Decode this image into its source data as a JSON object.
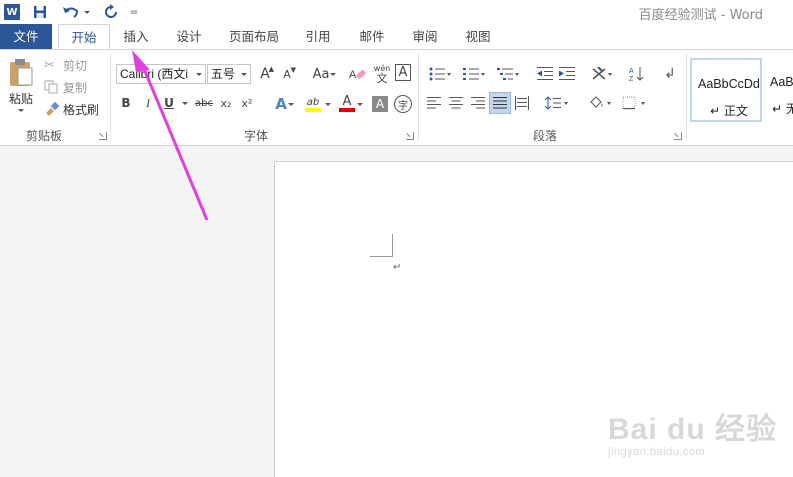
{
  "titlebar": {
    "title": "百度经验测试 - Word",
    "word_icon_text": "W",
    "qat_more": "="
  },
  "tabs": [
    "文件",
    "开始",
    "插入",
    "设计",
    "页面布局",
    "引用",
    "邮件",
    "审阅",
    "视图"
  ],
  "clipboard": {
    "paste": "粘贴",
    "cut": "剪切",
    "copy": "复制",
    "format_painter": "格式刷",
    "label": "剪贴板"
  },
  "font": {
    "name": "Calibri (西文i",
    "size": "五号",
    "grow": "A",
    "shrink": "A",
    "case": "Aa",
    "phonetic_top": "wén",
    "phonetic_bottom": "文",
    "border_char": "A",
    "bold": "B",
    "italic": "I",
    "underline": "U",
    "strike": "abc",
    "subscript": "x₂",
    "superscript": "x²",
    "effects": "A",
    "highlight": "ab",
    "color": "A",
    "shading": "A",
    "enclose": "字",
    "label": "字体"
  },
  "paragraph": {
    "label": "段落"
  },
  "styles": {
    "preview1": "AaBbCcDd",
    "name1": "↵ 正文",
    "preview2": "AaB",
    "name2": "↵ 无"
  },
  "document": {
    "para_mark": "↵"
  },
  "watermark": {
    "main": "Bai du 经验",
    "sub": "jingyan.baidu.com"
  },
  "colors": {
    "accent": "#2b579a",
    "arrow": "#e040e0",
    "highlight": "#ffff00",
    "font_color": "#e00000"
  }
}
